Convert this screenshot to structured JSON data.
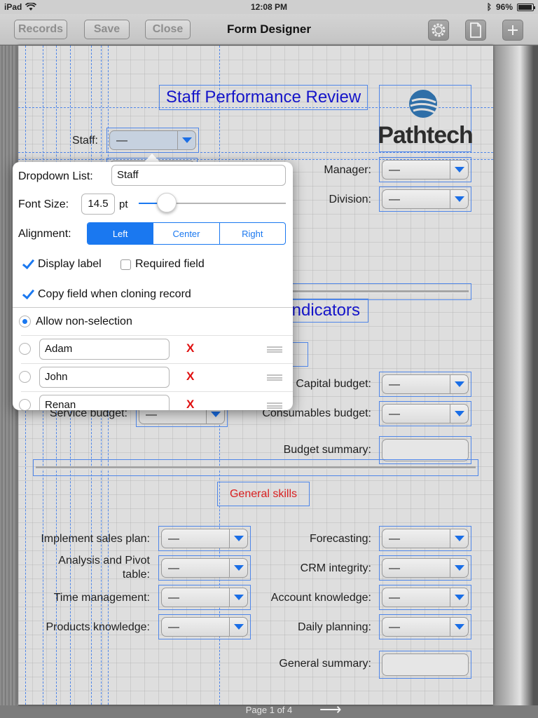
{
  "status_bar": {
    "device": "iPad",
    "time": "12:08 PM",
    "battery": "96%",
    "battery_level": 0.96
  },
  "navbar": {
    "title": "Form Designer",
    "records_label": "Records",
    "save_label": "Save",
    "close_label": "Close",
    "icons": [
      "gear-icon",
      "document-icon",
      "plus-icon"
    ]
  },
  "form": {
    "title": "Staff Performance Review",
    "logo_text": "Pathtech",
    "header_fields": [
      {
        "label": "Staff:",
        "value": "—"
      },
      {
        "label": "Manager:",
        "value": "—"
      },
      {
        "label": "Division:",
        "value": "—"
      }
    ],
    "indicators_title": "Indicators",
    "budget_fields": [
      {
        "label": "Capital budget:",
        "value": "—"
      },
      {
        "label": "Service budget:",
        "value": "—"
      },
      {
        "label": "Consumables budget:",
        "value": "—"
      }
    ],
    "budget_summary_label": "Budget summary:",
    "general_skills_title": "General skills",
    "skills_left": [
      {
        "label": "Implement sales plan:",
        "value": "—"
      },
      {
        "label": "Analysis and Pivot table:",
        "value": "—"
      },
      {
        "label": "Time management:",
        "value": "—"
      },
      {
        "label": "Products knowledge:",
        "value": "—"
      }
    ],
    "skills_right": [
      {
        "label": "Forecasting:",
        "value": "—"
      },
      {
        "label": "CRM integrity:",
        "value": "—"
      },
      {
        "label": "Account knowledge:",
        "value": "—"
      },
      {
        "label": "Daily planning:",
        "value": "—"
      }
    ],
    "general_summary_label": "General summary:",
    "page_indicator": "Page 1 of 4",
    "next_arrow": "⟶"
  },
  "popover": {
    "dropdown_list_label": "Dropdown List:",
    "dropdown_list_value": "Staff",
    "font_size_label": "Font Size:",
    "font_size_value": "14.5",
    "font_size_unit": "pt",
    "font_size_slider_fraction": 0.19,
    "alignment_label": "Alignment:",
    "alignment_options": [
      "Left",
      "Center",
      "Right"
    ],
    "alignment_selected": "Left",
    "display_label": {
      "label": "Display label",
      "checked": true
    },
    "required_field": {
      "label": "Required field",
      "checked": false
    },
    "copy_field": {
      "label": "Copy field when cloning record",
      "checked": true
    },
    "allow_non_selection": {
      "label": "Allow non-selection",
      "selected": true
    },
    "items": [
      {
        "value": "Adam",
        "delete": "X"
      },
      {
        "value": "John",
        "delete": "X"
      },
      {
        "value": "Renan",
        "delete": "X"
      }
    ]
  },
  "colors": {
    "accent": "#1a78f0",
    "guide": "#4f86e8",
    "title_blue": "#1515c9",
    "section_red": "#d92020"
  }
}
